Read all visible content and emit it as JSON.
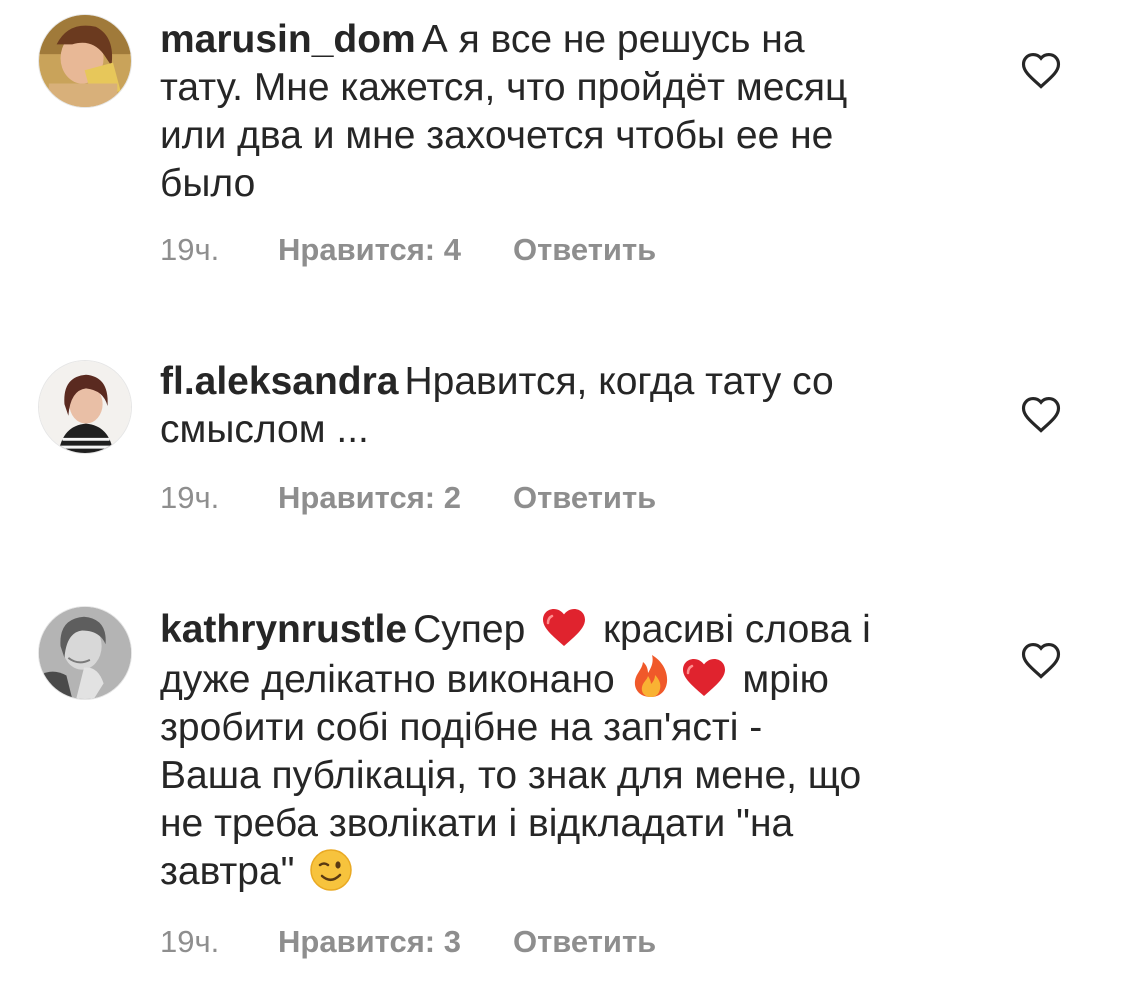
{
  "comments": [
    {
      "username": "marusin_dom",
      "body": [
        "А я все не решусь на",
        "тату. Мне кажется, что пройдёт месяц",
        "или два и мне захочется чтобы ее не",
        "было"
      ],
      "time": "19ч.",
      "likes": "Нравится: 4",
      "reply": "Ответить"
    },
    {
      "username": "fl.aleksandra",
      "body": [
        "Нравится, когда тату со",
        "смыслом ..."
      ],
      "time": "19ч.",
      "likes": "Нравится: 2",
      "reply": "Ответить"
    },
    {
      "username": "kathrynrustle",
      "segments": {
        "s1": "Супер",
        "s2": "красиві слова і",
        "s3": "дуже делікатно виконано",
        "s4": "мрію",
        "s5": "зробити собі подібне на зап'ясті -",
        "s6": "Ваша публікація, то знак для мене, що",
        "s7": "не треба зволікати і відкладати \"на",
        "s8": "завтра\""
      },
      "emojis": [
        "red-heart",
        "fire",
        "red-heart",
        "winking-face"
      ],
      "time": "19ч.",
      "likes": "Нравится: 3",
      "reply": "Ответить"
    }
  ],
  "colors": {
    "text": "#262626",
    "meta": "#8e8e8e",
    "heart_outline": "#262626",
    "emoji_red": "#e0232e"
  }
}
